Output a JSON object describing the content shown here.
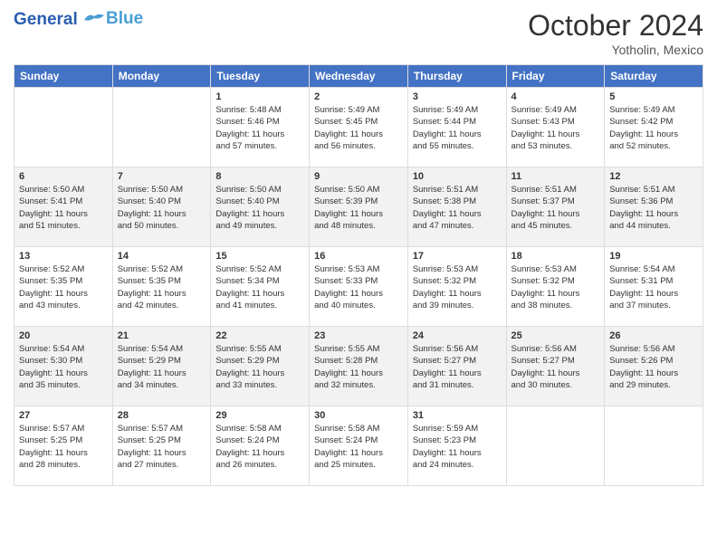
{
  "header": {
    "logo_line1": "General",
    "logo_line2": "Blue",
    "month_title": "October 2024",
    "location": "Yotholin, Mexico"
  },
  "weekdays": [
    "Sunday",
    "Monday",
    "Tuesday",
    "Wednesday",
    "Thursday",
    "Friday",
    "Saturday"
  ],
  "weeks": [
    [
      {
        "day": "",
        "info": ""
      },
      {
        "day": "",
        "info": ""
      },
      {
        "day": "1",
        "info": "Sunrise: 5:48 AM\nSunset: 5:46 PM\nDaylight: 11 hours\nand 57 minutes."
      },
      {
        "day": "2",
        "info": "Sunrise: 5:49 AM\nSunset: 5:45 PM\nDaylight: 11 hours\nand 56 minutes."
      },
      {
        "day": "3",
        "info": "Sunrise: 5:49 AM\nSunset: 5:44 PM\nDaylight: 11 hours\nand 55 minutes."
      },
      {
        "day": "4",
        "info": "Sunrise: 5:49 AM\nSunset: 5:43 PM\nDaylight: 11 hours\nand 53 minutes."
      },
      {
        "day": "5",
        "info": "Sunrise: 5:49 AM\nSunset: 5:42 PM\nDaylight: 11 hours\nand 52 minutes."
      }
    ],
    [
      {
        "day": "6",
        "info": "Sunrise: 5:50 AM\nSunset: 5:41 PM\nDaylight: 11 hours\nand 51 minutes."
      },
      {
        "day": "7",
        "info": "Sunrise: 5:50 AM\nSunset: 5:40 PM\nDaylight: 11 hours\nand 50 minutes."
      },
      {
        "day": "8",
        "info": "Sunrise: 5:50 AM\nSunset: 5:40 PM\nDaylight: 11 hours\nand 49 minutes."
      },
      {
        "day": "9",
        "info": "Sunrise: 5:50 AM\nSunset: 5:39 PM\nDaylight: 11 hours\nand 48 minutes."
      },
      {
        "day": "10",
        "info": "Sunrise: 5:51 AM\nSunset: 5:38 PM\nDaylight: 11 hours\nand 47 minutes."
      },
      {
        "day": "11",
        "info": "Sunrise: 5:51 AM\nSunset: 5:37 PM\nDaylight: 11 hours\nand 45 minutes."
      },
      {
        "day": "12",
        "info": "Sunrise: 5:51 AM\nSunset: 5:36 PM\nDaylight: 11 hours\nand 44 minutes."
      }
    ],
    [
      {
        "day": "13",
        "info": "Sunrise: 5:52 AM\nSunset: 5:35 PM\nDaylight: 11 hours\nand 43 minutes."
      },
      {
        "day": "14",
        "info": "Sunrise: 5:52 AM\nSunset: 5:35 PM\nDaylight: 11 hours\nand 42 minutes."
      },
      {
        "day": "15",
        "info": "Sunrise: 5:52 AM\nSunset: 5:34 PM\nDaylight: 11 hours\nand 41 minutes."
      },
      {
        "day": "16",
        "info": "Sunrise: 5:53 AM\nSunset: 5:33 PM\nDaylight: 11 hours\nand 40 minutes."
      },
      {
        "day": "17",
        "info": "Sunrise: 5:53 AM\nSunset: 5:32 PM\nDaylight: 11 hours\nand 39 minutes."
      },
      {
        "day": "18",
        "info": "Sunrise: 5:53 AM\nSunset: 5:32 PM\nDaylight: 11 hours\nand 38 minutes."
      },
      {
        "day": "19",
        "info": "Sunrise: 5:54 AM\nSunset: 5:31 PM\nDaylight: 11 hours\nand 37 minutes."
      }
    ],
    [
      {
        "day": "20",
        "info": "Sunrise: 5:54 AM\nSunset: 5:30 PM\nDaylight: 11 hours\nand 35 minutes."
      },
      {
        "day": "21",
        "info": "Sunrise: 5:54 AM\nSunset: 5:29 PM\nDaylight: 11 hours\nand 34 minutes."
      },
      {
        "day": "22",
        "info": "Sunrise: 5:55 AM\nSunset: 5:29 PM\nDaylight: 11 hours\nand 33 minutes."
      },
      {
        "day": "23",
        "info": "Sunrise: 5:55 AM\nSunset: 5:28 PM\nDaylight: 11 hours\nand 32 minutes."
      },
      {
        "day": "24",
        "info": "Sunrise: 5:56 AM\nSunset: 5:27 PM\nDaylight: 11 hours\nand 31 minutes."
      },
      {
        "day": "25",
        "info": "Sunrise: 5:56 AM\nSunset: 5:27 PM\nDaylight: 11 hours\nand 30 minutes."
      },
      {
        "day": "26",
        "info": "Sunrise: 5:56 AM\nSunset: 5:26 PM\nDaylight: 11 hours\nand 29 minutes."
      }
    ],
    [
      {
        "day": "27",
        "info": "Sunrise: 5:57 AM\nSunset: 5:25 PM\nDaylight: 11 hours\nand 28 minutes."
      },
      {
        "day": "28",
        "info": "Sunrise: 5:57 AM\nSunset: 5:25 PM\nDaylight: 11 hours\nand 27 minutes."
      },
      {
        "day": "29",
        "info": "Sunrise: 5:58 AM\nSunset: 5:24 PM\nDaylight: 11 hours\nand 26 minutes."
      },
      {
        "day": "30",
        "info": "Sunrise: 5:58 AM\nSunset: 5:24 PM\nDaylight: 11 hours\nand 25 minutes."
      },
      {
        "day": "31",
        "info": "Sunrise: 5:59 AM\nSunset: 5:23 PM\nDaylight: 11 hours\nand 24 minutes."
      },
      {
        "day": "",
        "info": ""
      },
      {
        "day": "",
        "info": ""
      }
    ]
  ]
}
